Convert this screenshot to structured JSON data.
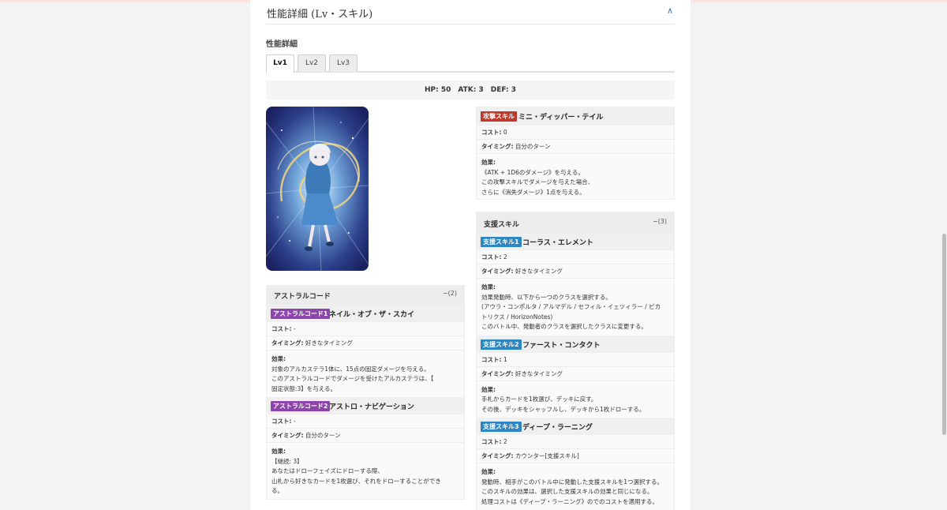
{
  "section": {
    "title": "性能詳細 (Lv・スキル)",
    "collapse_icon": "chevron-up-icon",
    "collapse_glyph": "∧"
  },
  "subtitle": "性能詳細",
  "tabs": [
    {
      "label": "Lv1",
      "active": true
    },
    {
      "label": "Lv2",
      "active": false
    },
    {
      "label": "Lv3",
      "active": false
    }
  ],
  "stats": "HP: 50　ATK: 3　DEF: 3",
  "attack_skill": {
    "badge": "攻撃スキル",
    "name": "ミニ・ディッパー・テイル",
    "cost": "0",
    "timing": "自分のターン",
    "effect_label": "効果:",
    "effect_lines": [
      "《ATK + 1D6のダメージ》を与える。",
      "この攻撃スキルでダメージを与えた場合、",
      "さらに《消失ダメージ》1点を与える。"
    ]
  },
  "labels": {
    "cost": "コスト:",
    "timing": "タイミング:",
    "effect": "効果:"
  },
  "astral": {
    "title": "アストラルコード",
    "count": "−(2)",
    "items": [
      {
        "badge": "アストラルコード1",
        "name": "ネイル・オブ・ザ・スカイ",
        "cost": "-",
        "timing": "好きなタイミング",
        "effect_lines": [
          "対象のアルカステラ1体に、15点の固定ダメージを与える。",
          "このアストラルコードでダメージを受けたアルカステラは、【",
          "固定状態:3】を与える。"
        ]
      },
      {
        "badge": "アストラルコード2",
        "name": "アストロ・ナビゲーション",
        "cost": "-",
        "timing": "自分のターン",
        "effect_lines": [
          "【継続: 3】",
          "あなたはドローフェイズにドローする際、",
          "山札から好きなカードを1枚選び、それをドローすることができ",
          "る。"
        ]
      }
    ]
  },
  "support": {
    "title": "支援スキル",
    "count": "−(3)",
    "items": [
      {
        "badge": "支援スキル1",
        "name": "コーラス・エレメント",
        "cost": "2",
        "timing": "好きなタイミング",
        "effect_lines": [
          "効果発動時、以下から一つのクラスを選択する。",
          "(アウラ・コンポルタ / アルマデル / セフィル・イェツィラー / ピカ",
          "トリクス / HorizonNotes)",
          "このバトル中、発動者のクラスを選択したクラスに変更する。"
        ]
      },
      {
        "badge": "支援スキル2",
        "name": "ファースト・コンタクト",
        "cost": "1",
        "timing": "好きなタイミング",
        "effect_lines": [
          "手札からカードを1枚選び、デッキに戻す。",
          "その後、デッキをシャッフルし、デッキから1枚ドローする。"
        ]
      },
      {
        "badge": "支援スキル3",
        "name": "ディープ・ラーニング",
        "cost": "2",
        "timing": "カウンター[支援スキル]",
        "effect_lines": [
          "発動時、相手がこのバトル中に発動した支援スキルを1つ選択する。",
          "このスキルの効果は、選択した支援スキルの効果と同じになる。",
          "処理コストは《ディープ・ラーニング》のでのコストを適用する。"
        ]
      }
    ]
  },
  "card_image": {
    "icon": "card-illustration",
    "colors": {
      "bg": "#1a2a6c",
      "glow": "#cde8ff",
      "ring": "#f5d67a"
    }
  }
}
